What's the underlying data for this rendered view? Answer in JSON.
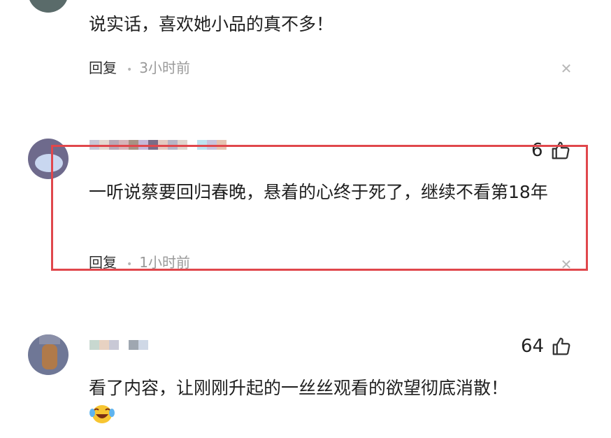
{
  "comments": [
    {
      "text": "说实话，喜欢她小品的真不多！",
      "reply_label": "回复",
      "time": "3小时前"
    },
    {
      "likes": "6",
      "text": "一听说蔡要回归春晚，悬着的心终于死了，继续不看第18年",
      "reply_label": "回复",
      "time": "1小时前"
    },
    {
      "likes": "64",
      "text": "看了内容，让刚刚升起的一丝丝观看的欲望彻底消散！"
    }
  ],
  "colors": {
    "highlight": "#e0474c",
    "muted": "#9a9a9a"
  },
  "icons": [
    "thumbs-up-icon",
    "close-icon",
    "laughing-crying-emoji"
  ]
}
